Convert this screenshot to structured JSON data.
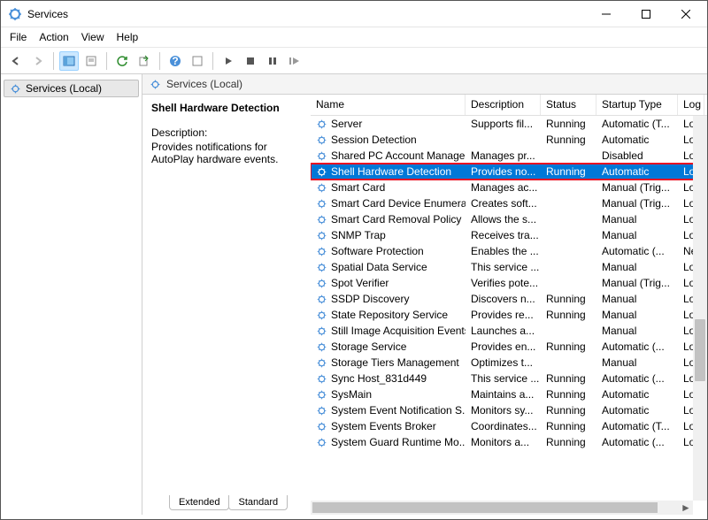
{
  "window": {
    "title": "Services"
  },
  "menu": {
    "file": "File",
    "action": "Action",
    "view": "View",
    "help": "Help"
  },
  "tree": {
    "root": "Services (Local)"
  },
  "pane": {
    "header": "Services (Local)",
    "selected_name": "Shell Hardware Detection",
    "desc_label": "Description:",
    "desc_text": "Provides notifications for AutoPlay hardware events."
  },
  "columns": {
    "name": "Name",
    "description": "Description",
    "status": "Status",
    "startup": "Startup Type",
    "logon": "Log"
  },
  "services": [
    {
      "name": "Server",
      "desc": "Supports fil...",
      "status": "Running",
      "startup": "Automatic (T...",
      "log": "Loc"
    },
    {
      "name": "Session Detection",
      "desc": "",
      "status": "Running",
      "startup": "Automatic",
      "log": "Loc"
    },
    {
      "name": "Shared PC Account Manager",
      "desc": "Manages pr...",
      "status": "",
      "startup": "Disabled",
      "log": "Loc"
    },
    {
      "name": "Shell Hardware Detection",
      "desc": "Provides no...",
      "status": "Running",
      "startup": "Automatic",
      "log": "Loc",
      "selected": true
    },
    {
      "name": "Smart Card",
      "desc": "Manages ac...",
      "status": "",
      "startup": "Manual (Trig...",
      "log": "Loc"
    },
    {
      "name": "Smart Card Device Enumera...",
      "desc": "Creates soft...",
      "status": "",
      "startup": "Manual (Trig...",
      "log": "Loc"
    },
    {
      "name": "Smart Card Removal Policy",
      "desc": "Allows the s...",
      "status": "",
      "startup": "Manual",
      "log": "Loc"
    },
    {
      "name": "SNMP Trap",
      "desc": "Receives tra...",
      "status": "",
      "startup": "Manual",
      "log": "Loc"
    },
    {
      "name": "Software Protection",
      "desc": "Enables the ...",
      "status": "",
      "startup": "Automatic (...",
      "log": "Net"
    },
    {
      "name": "Spatial Data Service",
      "desc": "This service ...",
      "status": "",
      "startup": "Manual",
      "log": "Loc"
    },
    {
      "name": "Spot Verifier",
      "desc": "Verifies pote...",
      "status": "",
      "startup": "Manual (Trig...",
      "log": "Loc"
    },
    {
      "name": "SSDP Discovery",
      "desc": "Discovers n...",
      "status": "Running",
      "startup": "Manual",
      "log": "Loc"
    },
    {
      "name": "State Repository Service",
      "desc": "Provides re...",
      "status": "Running",
      "startup": "Manual",
      "log": "Loc"
    },
    {
      "name": "Still Image Acquisition Events",
      "desc": "Launches a...",
      "status": "",
      "startup": "Manual",
      "log": "Loc"
    },
    {
      "name": "Storage Service",
      "desc": "Provides en...",
      "status": "Running",
      "startup": "Automatic (...",
      "log": "Loc"
    },
    {
      "name": "Storage Tiers Management",
      "desc": "Optimizes t...",
      "status": "",
      "startup": "Manual",
      "log": "Loc"
    },
    {
      "name": "Sync Host_831d449",
      "desc": "This service ...",
      "status": "Running",
      "startup": "Automatic (...",
      "log": "Loc"
    },
    {
      "name": "SysMain",
      "desc": "Maintains a...",
      "status": "Running",
      "startup": "Automatic",
      "log": "Loc"
    },
    {
      "name": "System Event Notification S...",
      "desc": "Monitors sy...",
      "status": "Running",
      "startup": "Automatic",
      "log": "Loc"
    },
    {
      "name": "System Events Broker",
      "desc": "Coordinates...",
      "status": "Running",
      "startup": "Automatic (T...",
      "log": "Loc"
    },
    {
      "name": "System Guard Runtime Mo...",
      "desc": "Monitors a...",
      "status": "Running",
      "startup": "Automatic (...",
      "log": "Loc"
    }
  ],
  "tabs": {
    "extended": "Extended",
    "standard": "Standard"
  }
}
